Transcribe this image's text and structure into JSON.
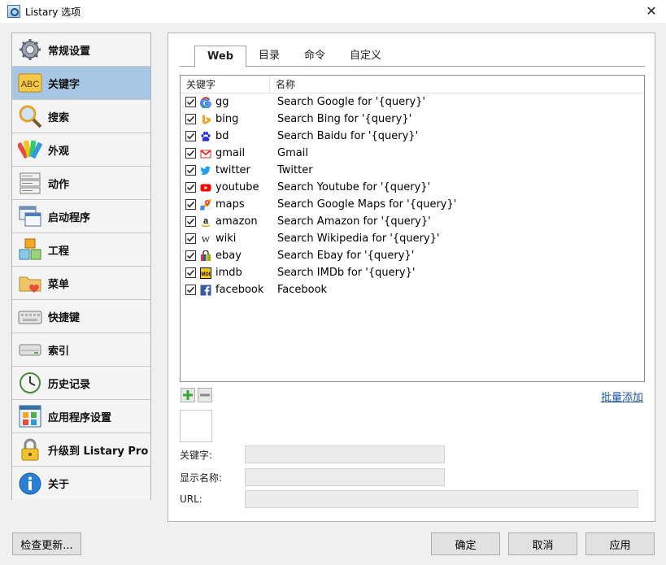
{
  "window": {
    "title": "Listary 选项",
    "close_icon": "close-icon"
  },
  "sidebar": {
    "items": [
      {
        "label": "常规设置",
        "icon": "gear-icon",
        "active": false
      },
      {
        "label": "关键字",
        "icon": "abc-icon",
        "active": true
      },
      {
        "label": "搜索",
        "icon": "magnifier-icon",
        "active": false
      },
      {
        "label": "外观",
        "icon": "palette-icon",
        "active": false
      },
      {
        "label": "动作",
        "icon": "open-file-icon",
        "active": false
      },
      {
        "label": "启动程序",
        "icon": "windows-icon",
        "active": false
      },
      {
        "label": "工程",
        "icon": "cubes-icon",
        "active": false
      },
      {
        "label": "菜单",
        "icon": "folder-heart-icon",
        "active": false
      },
      {
        "label": "快捷键",
        "icon": "keyboard-icon",
        "active": false
      },
      {
        "label": "索引",
        "icon": "drive-icon",
        "active": false
      },
      {
        "label": "历史记录",
        "icon": "clock-icon",
        "active": false
      },
      {
        "label": "应用程序设置",
        "icon": "app-grid-icon",
        "active": false
      },
      {
        "label": "升级到 Listary Pro",
        "icon": "lock-icon",
        "active": false
      },
      {
        "label": "关于",
        "icon": "info-icon",
        "active": false
      }
    ]
  },
  "tabs": [
    "Web",
    "目录",
    "命令",
    "自定义"
  ],
  "list": {
    "headers": {
      "keyword": "关键字",
      "name": "名称"
    },
    "rows": [
      {
        "keyword": "gg",
        "name": "Search Google for '{query}'",
        "icon": "google-icon",
        "checked": true
      },
      {
        "keyword": "bing",
        "name": "Search Bing for '{query}'",
        "icon": "bing-icon",
        "checked": true
      },
      {
        "keyword": "bd",
        "name": "Search Baidu for '{query}'",
        "icon": "baidu-icon",
        "checked": true
      },
      {
        "keyword": "gmail",
        "name": "Gmail",
        "icon": "gmail-icon",
        "checked": true
      },
      {
        "keyword": "twitter",
        "name": "Twitter",
        "icon": "twitter-icon",
        "checked": true
      },
      {
        "keyword": "youtube",
        "name": "Search Youtube for '{query}'",
        "icon": "youtube-icon",
        "checked": true
      },
      {
        "keyword": "maps",
        "name": "Search Google Maps for '{query}'",
        "icon": "google-maps-icon",
        "checked": true
      },
      {
        "keyword": "amazon",
        "name": "Search Amazon for '{query}'",
        "icon": "amazon-icon",
        "checked": true
      },
      {
        "keyword": "wiki",
        "name": "Search Wikipedia for '{query}'",
        "icon": "wikipedia-icon",
        "checked": true
      },
      {
        "keyword": "ebay",
        "name": "Search Ebay for '{query}'",
        "icon": "ebay-icon",
        "checked": true
      },
      {
        "keyword": "imdb",
        "name": "Search IMDb for '{query}'",
        "icon": "imdb-icon",
        "checked": true
      },
      {
        "keyword": "facebook",
        "name": "Facebook",
        "icon": "facebook-icon",
        "checked": true
      }
    ]
  },
  "batch_add": "批量添加",
  "form": {
    "keyword_label": "关键字:",
    "keyword_value": "",
    "display_name_label": "显示名称:",
    "display_name_value": "",
    "url_label": "URL:",
    "url_value": ""
  },
  "buttons": {
    "check_update": "检查更新...",
    "ok": "确定",
    "cancel": "取消",
    "apply": "应用"
  },
  "colors": {
    "active_nav": "#a7c6e3",
    "link": "#1a57a8",
    "add_green": "#3aa635"
  }
}
